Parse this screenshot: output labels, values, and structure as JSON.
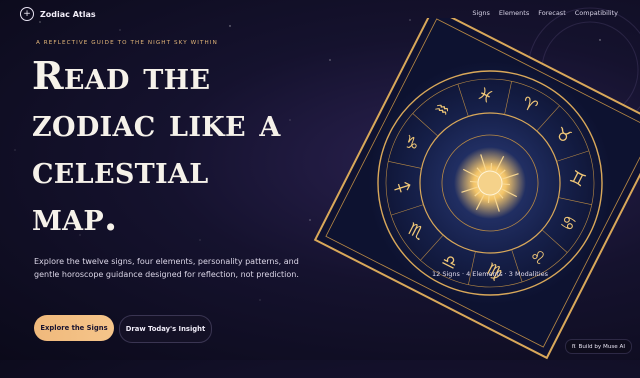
{
  "nav": {
    "brand": "Zodiac Atlas",
    "links": [
      "Signs",
      "Elements",
      "Forecast",
      "Compatibility"
    ]
  },
  "hero": {
    "eyebrow": "A REFLECTIVE GUIDE TO THE NIGHT SKY WITHIN",
    "headline_lines": [
      "Read the",
      "zodiac like a",
      "celestial",
      "map."
    ],
    "lede": "Explore the twelve signs, four elements, personality patterns, and gentle horoscope guidance designed for reflection, not prediction.",
    "primary_cta": "Explore the Signs",
    "secondary_cta": "Draw Today's Insight"
  },
  "art": {
    "caption": "12 Signs · 4 Elements · 3 Modalities",
    "glyphs": [
      "♈",
      "♉",
      "♊",
      "♋",
      "♌",
      "♍",
      "♎",
      "♏",
      "♐",
      "♑",
      "♒",
      "♓"
    ]
  },
  "badge": {
    "icon": "π",
    "label": "Build by Muse AI"
  },
  "colors": {
    "accent": "#e3b679",
    "background": "#0b0a1a",
    "gold": "#d9a85a"
  }
}
